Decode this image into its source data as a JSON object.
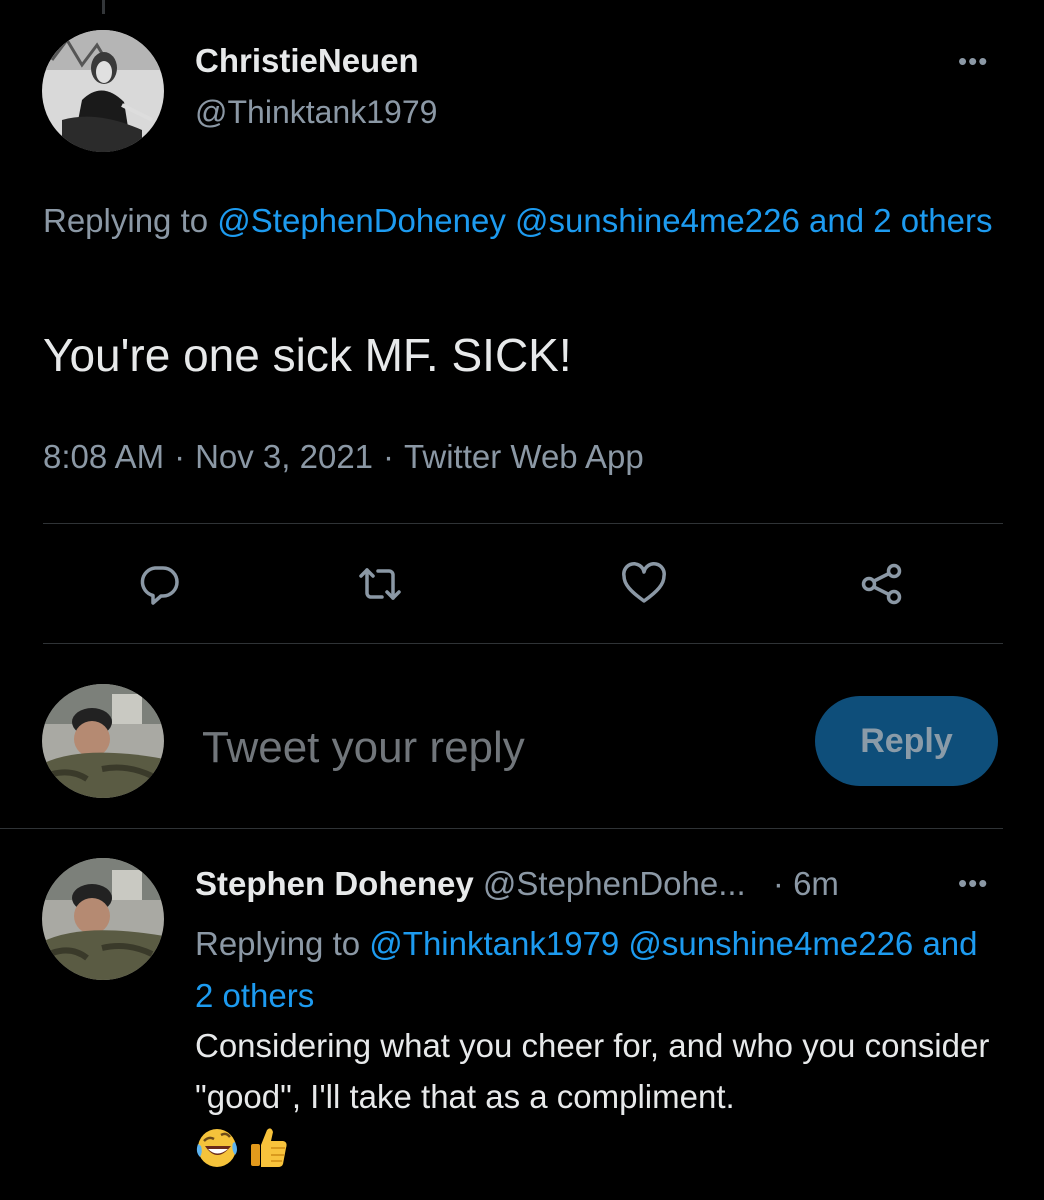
{
  "main_tweet": {
    "name": "ChristieNeuen",
    "handle": "@Thinktank1979",
    "replying_prefix": "Replying to",
    "replying_links": "@StephenDoheney @sunshine4me226 and 2 others",
    "text": "You're one sick MF. SICK!",
    "time": "8:08 AM",
    "date": "Nov 3, 2021",
    "source": "Twitter Web App",
    "separator": "·"
  },
  "actions": [
    "reply-icon",
    "retweet-icon",
    "like-icon",
    "share-icon"
  ],
  "compose": {
    "placeholder": "Tweet your reply",
    "button_label": "Reply"
  },
  "reply_tweet": {
    "name": "Stephen Doheney",
    "handle": "@StephenDohe...",
    "time": "· 6m",
    "replying_prefix": "Replying to",
    "replying_links": "@Thinktank1979 @sunshine4me226 and 2 others",
    "text": "Considering what you cheer for, and who you consider \"good\",  I'll take that as a compliment.",
    "emojis": [
      "rolling-on-floor-laughing-emoji",
      "thumbs-up-emoji"
    ]
  },
  "colors": {
    "background": "#000000",
    "text": "#e7e9ea",
    "secondary": "#8b98a5",
    "link": "#1d9bf0",
    "reply_button": "#0e4e7a"
  }
}
